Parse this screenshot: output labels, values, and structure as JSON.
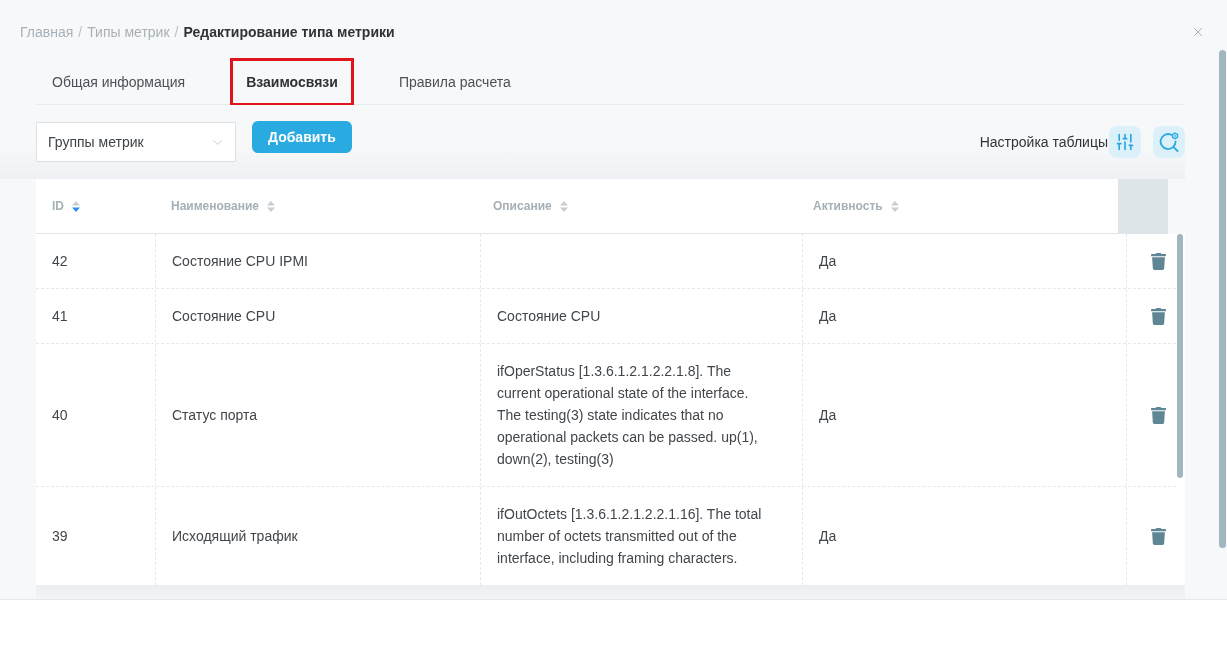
{
  "breadcrumb": [
    {
      "label": "Главная",
      "current": false,
      "separator": "/"
    },
    {
      "label": "Типы метрик",
      "current": false,
      "separator": "/"
    },
    {
      "label": "Редактирование типа метрики",
      "current": true
    }
  ],
  "tabs": [
    {
      "label": "Общая информация",
      "selected": false
    },
    {
      "label": "Взаимосвязи",
      "selected": true
    },
    {
      "label": "Правила расчета",
      "selected": false
    }
  ],
  "toolbar": {
    "group_select": {
      "placeholder": "Группы метрик"
    },
    "add_button": "Добавить",
    "table_settings_label": "Настройка таблицы"
  },
  "table": {
    "columns": [
      {
        "label": "ID",
        "sorted_descending": true
      },
      {
        "label": "Наименование",
        "sorted_descending": false
      },
      {
        "label": "Описание",
        "sorted_descending": false
      },
      {
        "label": "Активность",
        "sorted_descending": false
      }
    ],
    "rows": [
      {
        "id": "42",
        "name": "Состояние CPU IPMI",
        "activity": "Да"
      },
      {
        "id": "41",
        "name": "Состояние CPU",
        "description": "Состояние CPU",
        "activity": "Да"
      },
      {
        "id": "40",
        "name": "Статус порта",
        "description": "ifOperStatus [1.3.6.1.2.1.2.2.1.8]. The current operational state of the interface. The testing(3) state indicates that no operational packets can be passed. up(1), down(2), testing(3)",
        "activity": "Да"
      },
      {
        "id": "39",
        "name": "Исходящий трафик",
        "description": "ifOutOctets [1.3.6.1.2.1.2.2.1.16]. The total number of octets transmitted out of the interface, including framing characters.",
        "activity": "Да"
      }
    ]
  }
}
